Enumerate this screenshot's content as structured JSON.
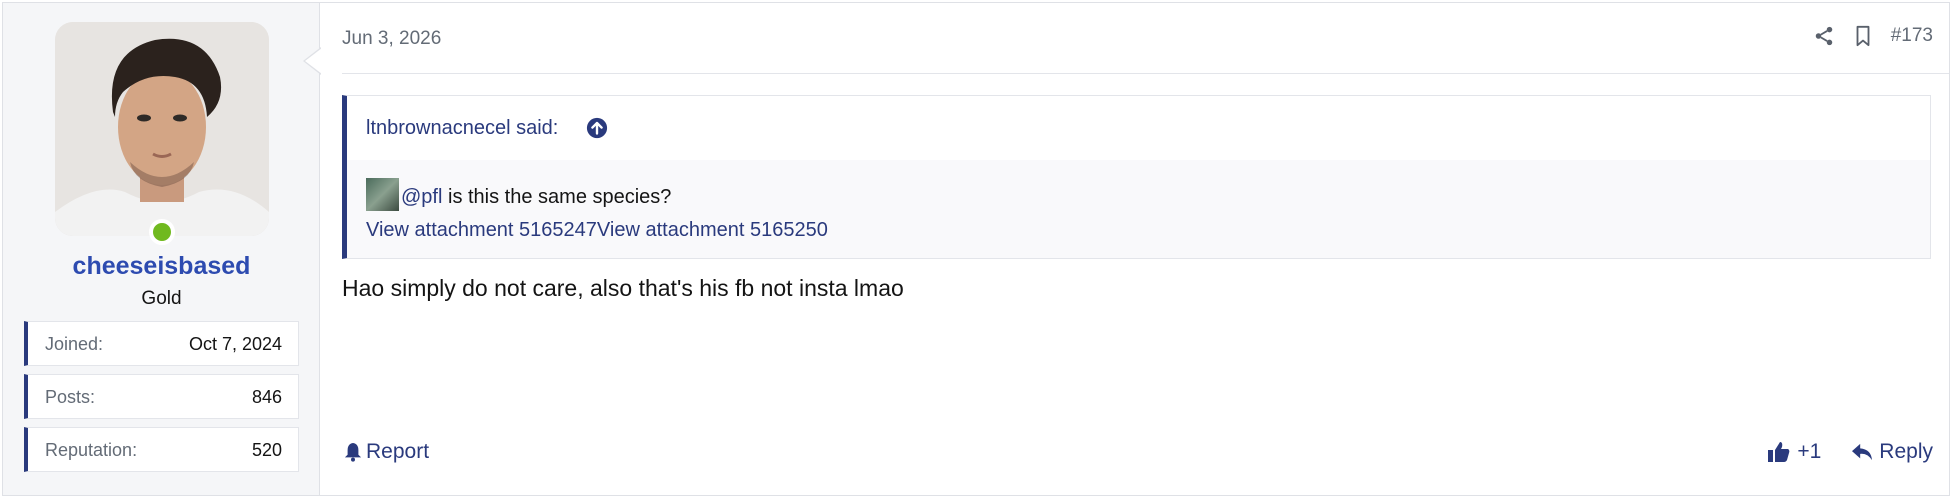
{
  "user": {
    "name": "cheeseisbased",
    "title": "Gold",
    "stats": [
      {
        "label": "Joined:",
        "value": "Oct 7, 2024"
      },
      {
        "label": "Posts:",
        "value": "846"
      },
      {
        "label": "Reputation:",
        "value": "520"
      }
    ]
  },
  "post": {
    "date": "Jun 3, 2026",
    "number": "#173",
    "message": "Hao simply do not care, also that's his fb not insta lmao"
  },
  "quote": {
    "author": "ltnbrownacnecel said:",
    "mention": "@pfl",
    "text": " is this the same species?",
    "attachment1": "View attachment 5165247",
    "attachment2": "View attachment 5165250"
  },
  "actions": {
    "report": "Report",
    "like_count": "+1",
    "reply": "Reply"
  },
  "colors": {
    "username": "#2d4bb0",
    "link": "#2a3a7d",
    "online": "#70b91f"
  },
  "icons": [
    "share-icon",
    "bookmark-icon",
    "arrow-up-circle-icon",
    "bell-icon",
    "thumbs-up-icon",
    "reply-icon"
  ]
}
